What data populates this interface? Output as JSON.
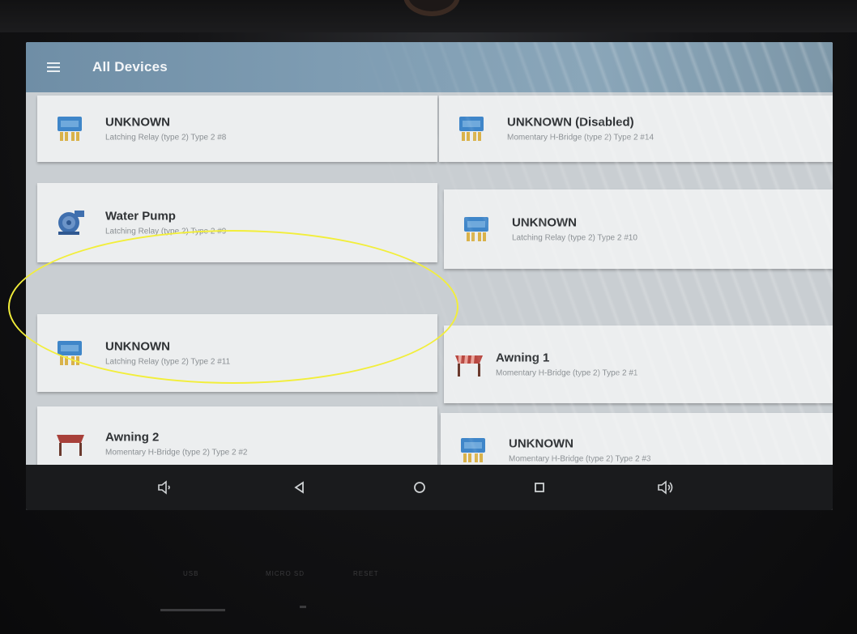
{
  "app": {
    "title": "All Devices"
  },
  "devices": [
    {
      "name": "UNKNOWN",
      "subtitle": "Latching Relay (type 2) Type 2 #8",
      "icon": "relay-box-icon"
    },
    {
      "name": "UNKNOWN (Disabled)",
      "subtitle": "Momentary H-Bridge (type 2) Type 2 #14",
      "icon": "relay-box-icon"
    },
    {
      "name": "Water Pump",
      "subtitle": "Latching Relay (type 2) Type 2 #9",
      "icon": "pump-icon"
    },
    {
      "name": "UNKNOWN",
      "subtitle": "Latching Relay (type 2) Type 2 #10",
      "icon": "relay-box-icon"
    },
    {
      "name": "UNKNOWN",
      "subtitle": "Latching Relay (type 2) Type 2 #11",
      "icon": "relay-box-icon"
    },
    {
      "name": "Awning 1",
      "subtitle": "Momentary H-Bridge (type 2) Type 2 #1",
      "icon": "awning-icon"
    },
    {
      "name": "Awning 2",
      "subtitle": "Momentary H-Bridge (type 2) Type 2 #2",
      "icon": "awning-icon"
    },
    {
      "name": "UNKNOWN",
      "subtitle": "Momentary H-Bridge (type 2) Type 2 #3",
      "icon": "relay-box-icon"
    }
  ],
  "navbar": {
    "buttons": [
      "volume-down-icon",
      "back-icon",
      "home-icon",
      "recents-icon",
      "volume-up-icon"
    ]
  },
  "hardware": {
    "ports": [
      "USB",
      "MICRO SD",
      "RESET"
    ]
  },
  "colors": {
    "appbar": "#7f9db3",
    "relay_blue": "#3f86c9",
    "relay_yellow": "#d9b24a",
    "awning_red": "#a8403a",
    "annotation": "#f2ee3a"
  }
}
